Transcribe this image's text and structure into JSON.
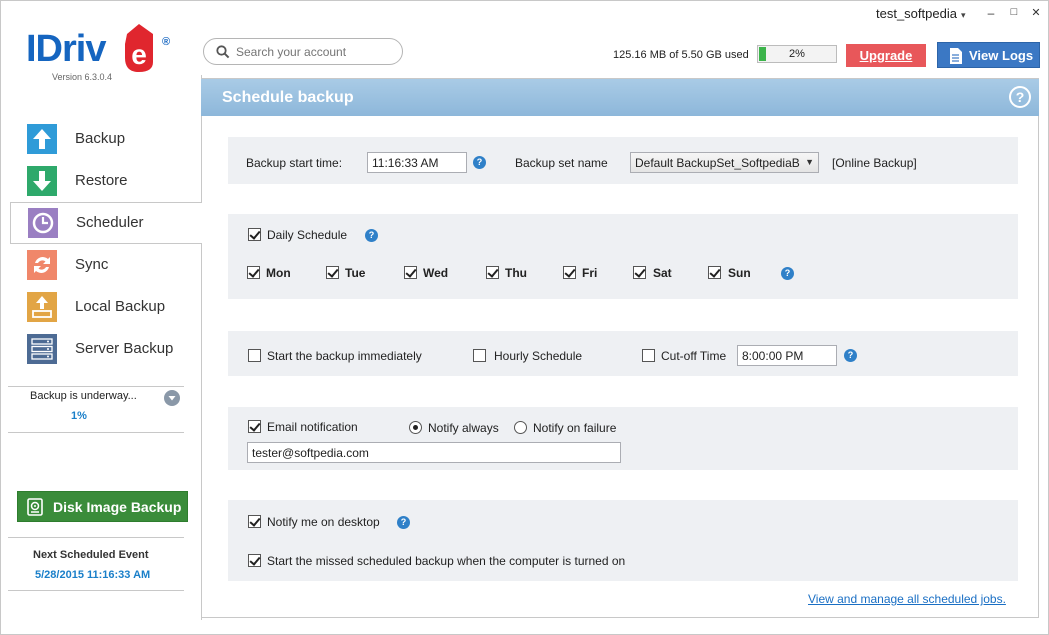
{
  "app": {
    "logo_text": "IDriv",
    "logo_e": "e",
    "logo_reg": "®",
    "version": "Version  6.3.0.4"
  },
  "topbar": {
    "username": "test_softpedia",
    "caret": "▾",
    "minimize": "–",
    "maximize": "□",
    "close": "✕",
    "usage": "125.16 MB of 5.50 GB used",
    "quota_percent": 2,
    "quota_label": "2%",
    "upgrade_label": "Upgrade",
    "view_logs_label": "View Logs"
  },
  "search": {
    "placeholder": "Search your account"
  },
  "sidebar": {
    "items": [
      {
        "label": "Backup",
        "icon": "upload-arrow-icon",
        "color": "#2f9bd8"
      },
      {
        "label": "Restore",
        "icon": "download-arrow-icon",
        "color": "#2ea96b"
      },
      {
        "label": "Scheduler",
        "icon": "clock-icon",
        "color": "#9a7fc2"
      },
      {
        "label": "Sync",
        "icon": "sync-icon",
        "color": "#f0876a"
      },
      {
        "label": "Local Backup",
        "icon": "drive-icon",
        "color": "#e2a545"
      },
      {
        "label": "Server Backup",
        "icon": "server-icon",
        "color": "#4d6b94"
      }
    ],
    "progress_text": "Backup is underway...",
    "progress_percent": "1%",
    "disk_image_label": "Disk Image Backup",
    "next_event_title": "Next Scheduled Event",
    "next_event_value": "5/28/2015 11:16:33 AM"
  },
  "main": {
    "title": "Schedule  backup",
    "help": "?",
    "backup_start_label": "Backup start time:",
    "backup_start_value": "11:16:33 AM",
    "backup_set_label": "Backup set name",
    "backup_set_value": "Default BackupSet_SoftpediaB",
    "backup_type": "[Online Backup]",
    "daily_schedule_label": "Daily Schedule",
    "days": [
      {
        "label": "Mon",
        "checked": true
      },
      {
        "label": "Tue",
        "checked": true
      },
      {
        "label": "Wed",
        "checked": true
      },
      {
        "label": "Thu",
        "checked": true
      },
      {
        "label": "Fri",
        "checked": true
      },
      {
        "label": "Sat",
        "checked": true
      },
      {
        "label": "Sun",
        "checked": true
      }
    ],
    "start_immediately_label": "Start the backup immediately",
    "hourly_label": "Hourly Schedule",
    "cutoff_label": "Cut-off Time",
    "cutoff_value": "8:00:00 PM",
    "email_notif_label": "Email notification",
    "notify_always_label": "Notify always",
    "notify_failure_label": "Notify on failure",
    "email_value": "tester@softpedia.com",
    "notify_desktop_label": "Notify me on desktop",
    "missed_label": "Start the missed scheduled backup when the computer is turned on",
    "manage_link": "View and manage all scheduled jobs."
  }
}
